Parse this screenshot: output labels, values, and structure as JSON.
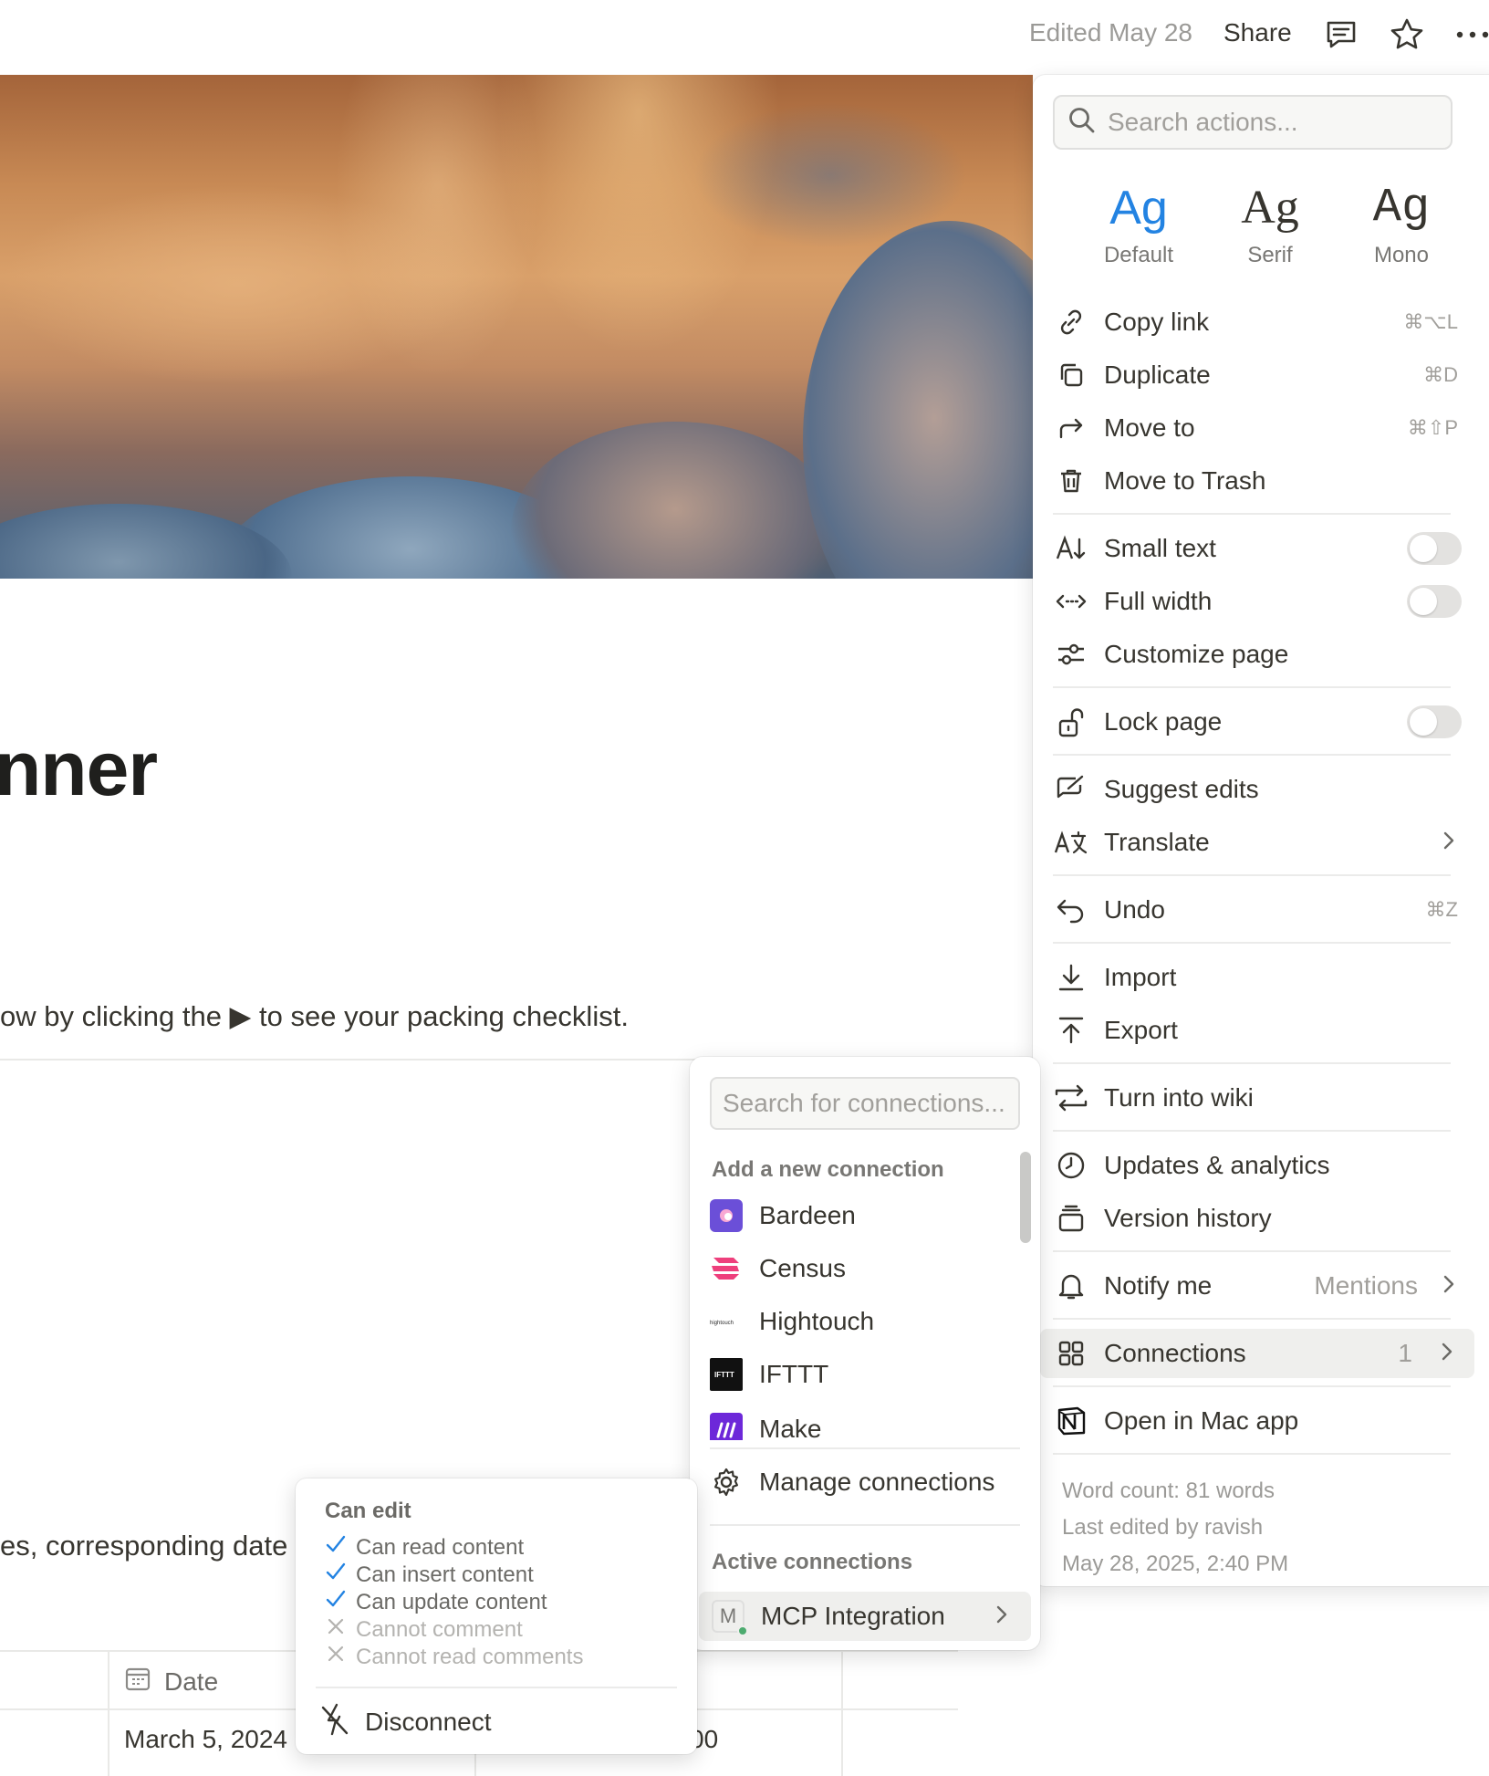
{
  "topbar": {
    "edited": "Edited May 28",
    "share": "Share",
    "icons": [
      "comment-icon",
      "star-icon",
      "more-icon"
    ]
  },
  "page": {
    "title_fragment": "nner",
    "text_line": "ow by clicking the ▶ to see your packing checklist.",
    "text_line2": "es, corresponding date",
    "table": {
      "header_date": "Date",
      "cell_date": "March 5, 2024",
      "cell_time": "00"
    }
  },
  "menu": {
    "search_placeholder": "Search actions...",
    "fonts": [
      {
        "ag": "Ag",
        "label": "Default",
        "selected": true
      },
      {
        "ag": "Ag",
        "label": "Serif",
        "selected": false
      },
      {
        "ag": "Ag",
        "label": "Mono",
        "selected": false
      }
    ],
    "items": {
      "copy_link": {
        "label": "Copy link",
        "shortcut": "⌘⌥L"
      },
      "duplicate": {
        "label": "Duplicate",
        "shortcut": "⌘D"
      },
      "move_to": {
        "label": "Move to",
        "shortcut": "⌘⇧P"
      },
      "move_to_trash": {
        "label": "Move to Trash"
      },
      "small_text": {
        "label": "Small text",
        "on": false
      },
      "full_width": {
        "label": "Full width",
        "on": false
      },
      "customize_page": {
        "label": "Customize page"
      },
      "lock_page": {
        "label": "Lock page",
        "on": false
      },
      "suggest_edits": {
        "label": "Suggest edits"
      },
      "translate": {
        "label": "Translate"
      },
      "undo": {
        "label": "Undo",
        "shortcut": "⌘Z"
      },
      "import": {
        "label": "Import"
      },
      "export": {
        "label": "Export"
      },
      "turn_into_wiki": {
        "label": "Turn into wiki"
      },
      "updates_analytics": {
        "label": "Updates & analytics"
      },
      "version_history": {
        "label": "Version history"
      },
      "notify_me": {
        "label": "Notify me",
        "value": "Mentions"
      },
      "connections": {
        "label": "Connections",
        "count": "1"
      },
      "open_mac_app": {
        "label": "Open in Mac app"
      }
    },
    "footer": {
      "word_count": "Word count: 81 words",
      "last_edited": "Last edited by ravish",
      "timestamp": "May 28, 2025, 2:40 PM"
    }
  },
  "connections": {
    "search_placeholder": "Search for connections...",
    "add_header": "Add a new connection",
    "list": [
      {
        "label": "Bardeen",
        "color": "#6b4fd8"
      },
      {
        "label": "Census",
        "color": "#ee3f7c"
      },
      {
        "label": "Hightouch",
        "color": "#2b2b2b"
      },
      {
        "label": "IFTTT",
        "color": "#111111"
      },
      {
        "label": "Make",
        "color": "#6d28d9"
      }
    ],
    "manage": "Manage connections",
    "active_header": "Active connections",
    "active_item": "MCP Integration",
    "active_logo_letter": "M"
  },
  "permissions": {
    "title": "Can edit",
    "allowed": [
      "Can read content",
      "Can insert content",
      "Can update content"
    ],
    "denied": [
      "Cannot comment",
      "Cannot read comments"
    ],
    "disconnect": "Disconnect"
  },
  "colors": {
    "accent": "#2383e2",
    "text": "#37352f",
    "muted": "#9b9a97"
  }
}
